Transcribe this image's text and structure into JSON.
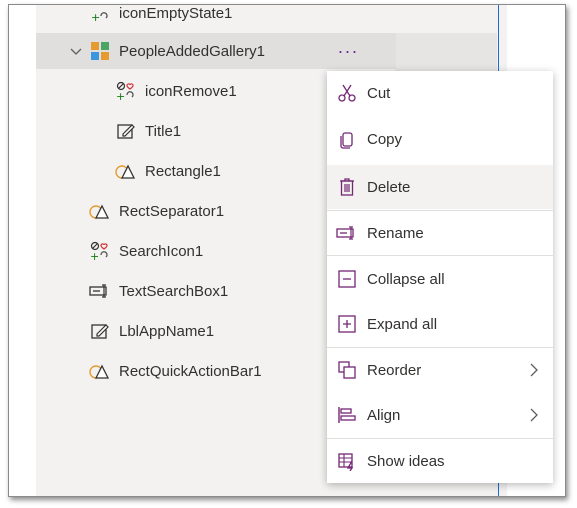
{
  "tree": {
    "items": [
      {
        "label": "iconEmptyState1"
      },
      {
        "label": "PeopleAddedGallery1"
      },
      {
        "label": "iconRemove1"
      },
      {
        "label": "Title1"
      },
      {
        "label": "Rectangle1"
      },
      {
        "label": "RectSeparator1"
      },
      {
        "label": "SearchIcon1"
      },
      {
        "label": "TextSearchBox1"
      },
      {
        "label": "LblAppName1"
      },
      {
        "label": "RectQuickActionBar1"
      }
    ],
    "more_label": "···"
  },
  "menu": {
    "items": [
      {
        "label": "Cut",
        "icon": "scissors-icon"
      },
      {
        "label": "Copy",
        "icon": "copy-icon"
      },
      {
        "label": "Delete",
        "icon": "trash-icon"
      },
      {
        "label": "Rename",
        "icon": "rename-icon"
      },
      {
        "label": "Collapse all",
        "icon": "collapse-icon"
      },
      {
        "label": "Expand all",
        "icon": "expand-icon"
      },
      {
        "label": "Reorder",
        "icon": "reorder-icon"
      },
      {
        "label": "Align",
        "icon": "align-icon"
      },
      {
        "label": "Show ideas",
        "icon": "ideas-icon"
      }
    ]
  },
  "colors": {
    "accent": "#742774",
    "selected_row": "#e1dfdd",
    "panel_bg": "#f3f2f1",
    "hover": "#f3f2f1"
  }
}
